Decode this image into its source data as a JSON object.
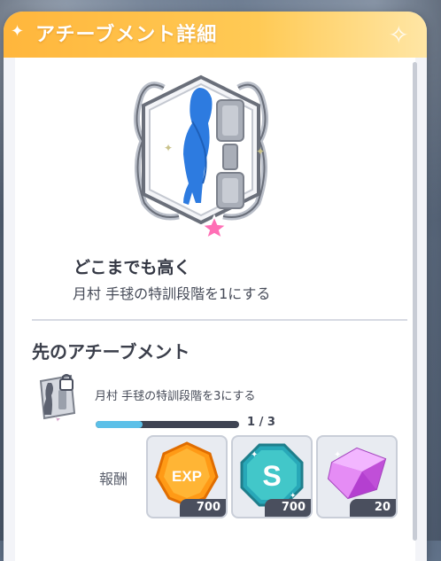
{
  "header": {
    "title": "アチーブメント詳細"
  },
  "achievement": {
    "name": "どこまでも高く",
    "description": "月村 手毬の特訓段階を1にする"
  },
  "next_section": {
    "title": "先のアチーブメント",
    "description": "月村 手毬の特訓段階を3にする",
    "progress_text": "1 / 3",
    "progress_fraction": 0.33,
    "reward_label": "報酬",
    "rewards": [
      {
        "icon": "exp-icon",
        "text": "EXP",
        "count": "700"
      },
      {
        "icon": "s-coin-icon",
        "text": "S",
        "count": "700"
      },
      {
        "icon": "gem-icon",
        "count": "20"
      }
    ]
  },
  "colors": {
    "header_start": "#ffb63c",
    "header_end": "#ffe6a5",
    "progress_fill": "#5cc0e8",
    "star": "#ff6fb5"
  }
}
